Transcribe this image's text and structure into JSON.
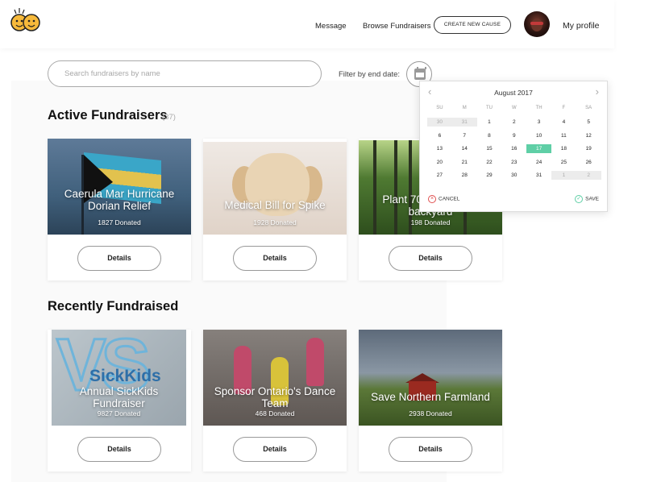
{
  "header": {
    "nav_message": "Message",
    "nav_browse": "Browse Fundraisers",
    "create_button": "CREATE NEW CAUSE",
    "profile_label": "My profile"
  },
  "search": {
    "placeholder": "Search fundraisers by name",
    "filter_label": "Filter by end date:"
  },
  "active": {
    "title": "Active Fundraisers",
    "count": "(37)",
    "cards": [
      {
        "title": "Caerula Mar Hurricane Dorian Relief",
        "donated": "1827 Donated",
        "button": "Details"
      },
      {
        "title": "Medical Bill for Spike",
        "donated": "1928 Donated",
        "button": "Details"
      },
      {
        "title": "Plant 70 trees in my backyard",
        "donated": "198 Donated",
        "button": "Details"
      }
    ]
  },
  "recent": {
    "title": "Recently Fundraised",
    "cards": [
      {
        "title": "Annual SickKids Fundraiser",
        "donated": "9827 Donated",
        "button": "Details",
        "logo_text": "SickKids"
      },
      {
        "title": "Sponsor Ontario's Dance Team",
        "donated": "468 Donated",
        "button": "Details"
      },
      {
        "title": "Save Northern Farmland",
        "donated": "2938 Donated",
        "button": "Details"
      }
    ]
  },
  "calendar": {
    "month": "August 2017",
    "weekdays": [
      "SU",
      "M",
      "TU",
      "W",
      "TH",
      "F",
      "SA"
    ],
    "weeks": [
      [
        "30",
        "31",
        "1",
        "2",
        "3",
        "4",
        "5"
      ],
      [
        "6",
        "7",
        "8",
        "9",
        "10",
        "11",
        "12"
      ],
      [
        "13",
        "14",
        "15",
        "16",
        "17",
        "18",
        "19"
      ],
      [
        "20",
        "21",
        "22",
        "23",
        "24",
        "25",
        "26"
      ],
      [
        "27",
        "28",
        "29",
        "30",
        "31",
        "1",
        "2"
      ]
    ],
    "selected_day": "17",
    "cancel_label": "CANCEL",
    "save_label": "SAVE",
    "accent_color": "#5fcfa6"
  }
}
